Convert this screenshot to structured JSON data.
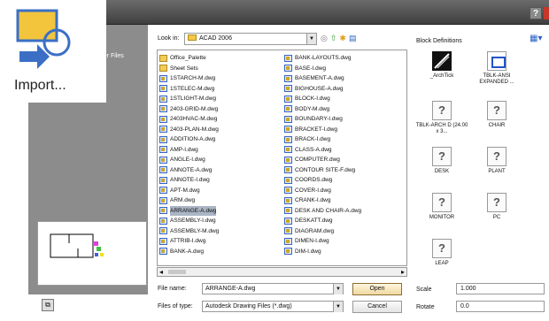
{
  "left_panel": {
    "link": "Center Files"
  },
  "import_ribbon": {
    "label": "Import..."
  },
  "lookin": {
    "label": "Look in:",
    "value": "ACAD 2006"
  },
  "files": {
    "col1": [
      {
        "name": "Office_Palette",
        "type": "folder"
      },
      {
        "name": "Sheet Sets",
        "type": "folder"
      },
      {
        "name": "1STARCH-M.dwg",
        "type": "dwg"
      },
      {
        "name": "1STELEC-M.dwg",
        "type": "dwg"
      },
      {
        "name": "1STLIGHT-M.dwg",
        "type": "dwg"
      },
      {
        "name": "2403-GRID-M.dwg",
        "type": "dwg"
      },
      {
        "name": "2403HVAC-M.dwg",
        "type": "dwg"
      },
      {
        "name": "2403-PLAN-M.dwg",
        "type": "dwg"
      },
      {
        "name": "ADDITION-A.dwg",
        "type": "dwg"
      },
      {
        "name": "AMP-I.dwg",
        "type": "dwg"
      },
      {
        "name": "ANGLE-I.dwg",
        "type": "dwg"
      },
      {
        "name": "ANNOTE-A.dwg",
        "type": "dwg"
      },
      {
        "name": "ANNOTE-I.dwg",
        "type": "dwg"
      },
      {
        "name": "APT-M.dwg",
        "type": "dwg"
      },
      {
        "name": "ARM.dwg",
        "type": "dwg"
      },
      {
        "name": "ARRANGE-A.dwg",
        "type": "dwg",
        "selected": true
      },
      {
        "name": "ASSEMBLY-I.dwg",
        "type": "dwg"
      },
      {
        "name": "ASSEMBLY-M.dwg",
        "type": "dwg"
      },
      {
        "name": "ATTRIB-I.dwg",
        "type": "dwg"
      },
      {
        "name": "BANK-A.dwg",
        "type": "dwg"
      }
    ],
    "col2": [
      {
        "name": "BANK-LAYOUTS.dwg",
        "type": "dwg"
      },
      {
        "name": "BASE-I.dwg",
        "type": "dwg"
      },
      {
        "name": "BASEMENT-A.dwg",
        "type": "dwg"
      },
      {
        "name": "BIGHOUSE-A.dwg",
        "type": "dwg"
      },
      {
        "name": "BLOCK-I.dwg",
        "type": "dwg"
      },
      {
        "name": "BODY-M.dwg",
        "type": "dwg"
      },
      {
        "name": "BOUNDARY-I.dwg",
        "type": "dwg"
      },
      {
        "name": "BRACKET-I.dwg",
        "type": "dwg"
      },
      {
        "name": "BRACK-I.dwg",
        "type": "dwg"
      },
      {
        "name": "CLASS-A.dwg",
        "type": "dwg"
      },
      {
        "name": "COMPUTER.dwg",
        "type": "dwg"
      },
      {
        "name": "CONTOUR SITE-F.dwg",
        "type": "dwg"
      },
      {
        "name": "COORDS.dwg",
        "type": "dwg"
      },
      {
        "name": "COVER-I.dwg",
        "type": "dwg"
      },
      {
        "name": "CRANK-I.dwg",
        "type": "dwg"
      },
      {
        "name": "DESK AND CHAIR-A.dwg",
        "type": "dwg"
      },
      {
        "name": "DESKATT.dwg",
        "type": "dwg"
      },
      {
        "name": "DIAGRAM.dwg",
        "type": "dwg"
      },
      {
        "name": "DIMEN-I.dwg",
        "type": "dwg"
      },
      {
        "name": "DIM-I.dwg",
        "type": "dwg"
      }
    ]
  },
  "filename": {
    "label": "File name:",
    "value": "ARRANGE-A.dwg"
  },
  "filetype": {
    "label": "Files of type:",
    "value": "Autodesk Drawing Files (*.dwg)"
  },
  "buttons": {
    "open": "Open",
    "cancel": "Cancel"
  },
  "block_defs": {
    "title": "Block Definitions",
    "items": [
      {
        "label": "_ArchTick",
        "icon": "archtick-thumbnail"
      },
      {
        "label": "TBLK-ANSI EXPANDED ...",
        "icon": "titleblock-thumbnail"
      },
      {
        "label": "TBLK-ARCH D (24.00 x 3...",
        "icon": "unknown-block-icon"
      },
      {
        "label": "CHAIR",
        "icon": "unknown-block-icon"
      },
      {
        "label": "DESK",
        "icon": "unknown-block-icon"
      },
      {
        "label": "PLANT",
        "icon": "unknown-block-icon"
      },
      {
        "label": "MONITOR",
        "icon": "unknown-block-icon"
      },
      {
        "label": "PC",
        "icon": "unknown-block-icon"
      },
      {
        "label": "LEAP",
        "icon": "unknown-block-icon"
      }
    ]
  },
  "scale": {
    "label": "Scale",
    "value": "1.000"
  },
  "rotate": {
    "label": "Rotate",
    "value": "0.0"
  }
}
